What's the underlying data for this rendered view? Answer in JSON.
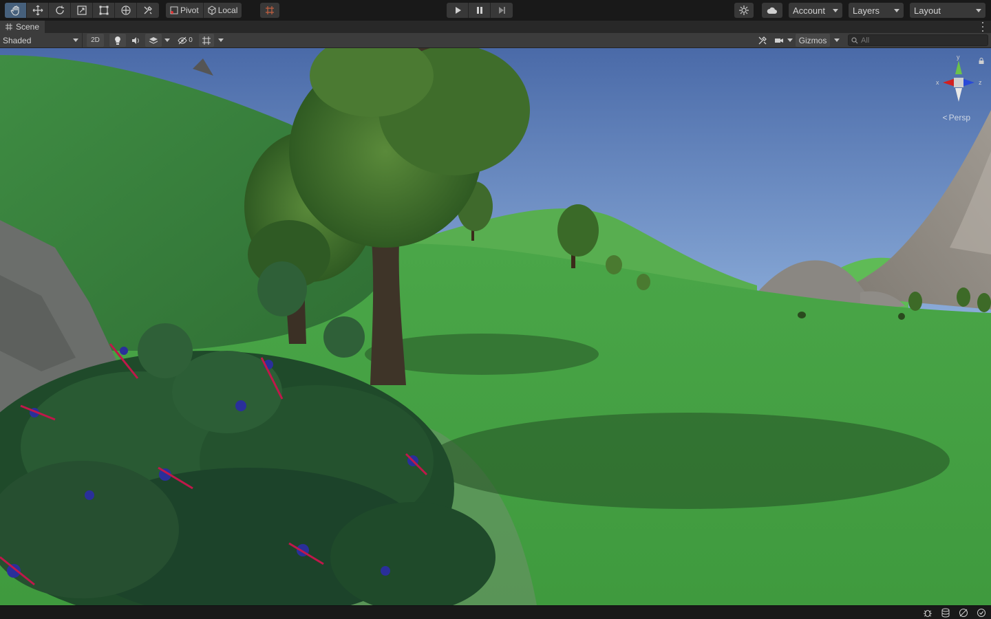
{
  "toolbar": {
    "tools": [
      {
        "name": "hand-tool-icon",
        "active": true
      },
      {
        "name": "move-tool-icon",
        "active": false
      },
      {
        "name": "rotate-tool-icon",
        "active": false
      },
      {
        "name": "scale-tool-icon",
        "active": false
      },
      {
        "name": "rect-tool-icon",
        "active": false
      },
      {
        "name": "transform-tool-icon",
        "active": false
      },
      {
        "name": "custom-tool-icon",
        "active": false
      }
    ],
    "pivot_label": "Pivot",
    "local_label": "Local",
    "account_label": "Account",
    "layers_label": "Layers",
    "layout_label": "Layout",
    "accent": "#46607c"
  },
  "scene_tab": {
    "title": "Scene"
  },
  "scene_toolbar": {
    "draw_mode": "Shaded",
    "mode_2d_label": "2D",
    "hidden_count": "0",
    "gizmos_label": "Gizmos",
    "search_placeholder": "All"
  },
  "viewport": {
    "projection_label": "Persp",
    "axis_labels": {
      "x": "x",
      "y": "y",
      "z": "z"
    },
    "colors": {
      "sky_top": "#4a6aa8",
      "sky_bottom": "#8fb0dc",
      "grass": "#4fa34a",
      "x_axis": "#d12020",
      "y_axis": "#6cc24a",
      "z_axis": "#2a4ad8"
    }
  },
  "statusbar": {
    "icons": [
      "debug-icon",
      "cache-icon",
      "network-icon",
      "progress-icon"
    ]
  }
}
